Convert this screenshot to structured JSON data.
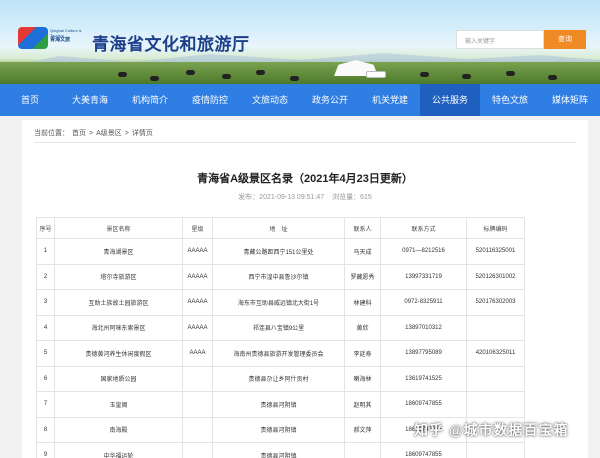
{
  "header": {
    "logo_en": "Qinghai Culture & Tourism",
    "logo_cn": "青海文旅",
    "site_title": "青海省文化和旅游厅",
    "search_placeholder": "输入关键字",
    "search_button": "查询"
  },
  "nav": [
    {
      "label": "首页",
      "active": false
    },
    {
      "label": "大美青海",
      "active": false
    },
    {
      "label": "机构简介",
      "active": false
    },
    {
      "label": "疫情防控",
      "active": false
    },
    {
      "label": "文旅动态",
      "active": false
    },
    {
      "label": "政务公开",
      "active": false
    },
    {
      "label": "机关党建",
      "active": false
    },
    {
      "label": "公共服务",
      "active": true
    },
    {
      "label": "特色文旅",
      "active": false
    },
    {
      "label": "媒体矩阵",
      "active": false
    }
  ],
  "breadcrumb": {
    "prefix": "当前位置：",
    "items": [
      "首页",
      ">",
      "A级景区",
      ">",
      "详情页"
    ]
  },
  "article": {
    "title": "青海省A级景区名录（2021年4月23日更新）",
    "published": "发布：2021-09-13 09:51:47",
    "views": "浏览量：615"
  },
  "table": {
    "columns": [
      "序号",
      "景区名称",
      "星级",
      "地　址",
      "联系人",
      "联系方式",
      "标牌编码"
    ],
    "rows": [
      [
        "1",
        "青海湖景区",
        "AAAAA",
        "青藏公路距西宁151公里处",
        "马天成",
        "0971—8212516",
        "520116325001"
      ],
      [
        "2",
        "塔尔寺旅游区",
        "AAAAA",
        "西宁市湟中县鲁沙尔镇",
        "罗藏愿秀",
        "13997331719",
        "520126301002"
      ],
      [
        "3",
        "互助土族故土园旅游区",
        "AAAAA",
        "海东市互助县威远镇北大街1号",
        "林建科",
        "0972-8325911",
        "520176302003"
      ],
      [
        "4",
        "海北州阿咪东索景区",
        "AAAAA",
        "祁连县八宝镇9公里",
        "黄欣",
        "13897010312",
        ""
      ],
      [
        "5",
        "贵德黄河养生休闲度假区",
        "AAAA",
        "海南州贵德县旅游开发管理委员会",
        "李廷寿",
        "13897795089",
        "420106325011"
      ],
      [
        "6",
        "国家地质公园",
        "",
        "贵德县尕让乡阿什贡村",
        "喇海林",
        "13619741525",
        ""
      ],
      [
        "7",
        "玉皇阁",
        "",
        "贵德县河阴镇",
        "赵明其",
        "18609747855",
        ""
      ],
      [
        "8",
        "南海殿",
        "",
        "贵德县河阴镇",
        "郝文萍",
        "18609747855",
        ""
      ],
      [
        "9",
        "中华福运轮",
        "",
        "贵德县河阴镇",
        "",
        "18609747855",
        ""
      ]
    ]
  },
  "watermark": "知乎 @城市数据百宝箱",
  "colors": {
    "nav_bg": "#2f7ee3",
    "nav_active": "#1f5fbf",
    "search_button": "#f08a24",
    "title_blue": "#1c3f8a"
  }
}
